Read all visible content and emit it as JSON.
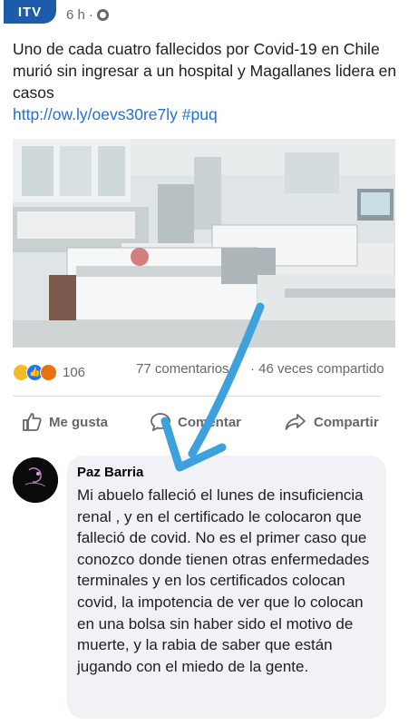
{
  "post": {
    "page_logo": "ITV",
    "time": "6 h",
    "caption": "Uno de cada cuatro fallecidos por Covid-19 en Chile murió sin ingresar a un hospital y Magallanes lidera en casos",
    "link_text": "http://ow.ly/oevs30re7ly #puq"
  },
  "stats": {
    "reaction_count": "106",
    "comments": "77 comentarios",
    "shares": "· 46 veces compartido"
  },
  "actions": {
    "like": "Me gusta",
    "comment": "Comentar",
    "share": "Compartir"
  },
  "comment": {
    "author": "Paz Barria",
    "text": "Mi abuelo falleció  el lunes de insuficiencia renal , y en el certificado le colocaron que falleció  de covid. No es el primer caso que conozco donde tienen otras enfermedades terminales y en los certificados colocan covid, la impotencia de ver que lo colocan en una bolsa sin haber sido el  motivo de muerte, y la rabia de saber que están  jugando con el miedo de la gente."
  },
  "colors": {
    "link": "#216fdb",
    "arrow": "#3ea0dd",
    "like": "#1877f2"
  }
}
